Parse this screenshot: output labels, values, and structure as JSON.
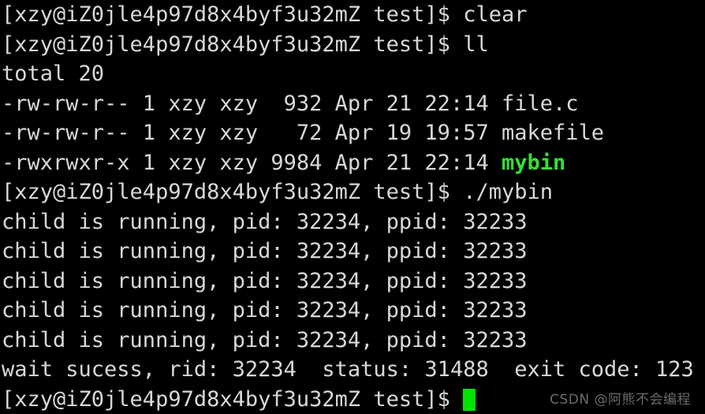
{
  "terminal": {
    "background_color": "#000000",
    "foreground_color": "#d8d8d8",
    "executable_color": "#35e035",
    "cursor_color": "#00e500",
    "prompt": "[xzy@iZ0jle4p97d8x4byf3u32mZ test]$ ",
    "lines": [
      {
        "id": "line-1",
        "type": "prompt-command",
        "prompt": "[xzy@iZ0jle4p97d8x4byf3u32mZ test]$ ",
        "command": "clear"
      },
      {
        "id": "line-2",
        "type": "prompt-command",
        "prompt": "[xzy@iZ0jle4p97d8x4byf3u32mZ test]$ ",
        "command": "ll"
      },
      {
        "id": "line-3",
        "type": "output",
        "text": "total 20"
      },
      {
        "id": "line-4",
        "type": "file-entry",
        "text": "-rw-rw-r-- 1 xzy xzy  932 Apr 21 22:14 ",
        "name": "file.c",
        "executable": false
      },
      {
        "id": "line-5",
        "type": "file-entry",
        "text": "-rw-rw-r-- 1 xzy xzy   72 Apr 19 19:57 ",
        "name": "makefile",
        "executable": false
      },
      {
        "id": "line-6",
        "type": "file-entry",
        "text": "-rwxrwxr-x 1 xzy xzy 9984 Apr 21 22:14 ",
        "name": "mybin",
        "executable": true
      },
      {
        "id": "line-7",
        "type": "prompt-command",
        "prompt": "[xzy@iZ0jle4p97d8x4byf3u32mZ test]$ ",
        "command": "./mybin"
      },
      {
        "id": "line-8",
        "type": "output",
        "text": "child is running, pid: 32234, ppid: 32233"
      },
      {
        "id": "line-9",
        "type": "output",
        "text": "child is running, pid: 32234, ppid: 32233"
      },
      {
        "id": "line-10",
        "type": "output",
        "text": "child is running, pid: 32234, ppid: 32233"
      },
      {
        "id": "line-11",
        "type": "output",
        "text": "child is running, pid: 32234, ppid: 32233"
      },
      {
        "id": "line-12",
        "type": "output",
        "text": "child is running, pid: 32234, ppid: 32233"
      },
      {
        "id": "line-13",
        "type": "output",
        "text": "wait sucess, rid: 32234  status: 31488  exit code: 123"
      },
      {
        "id": "line-14",
        "type": "prompt-cursor",
        "prompt": "[xzy@iZ0jle4p97d8x4byf3u32mZ test]$ ",
        "command": ""
      }
    ]
  },
  "files": [
    {
      "permissions": "-rw-rw-r--",
      "links": "1",
      "owner": "xzy",
      "group": "xzy",
      "size": "932",
      "month": "Apr",
      "day": "21",
      "time": "22:14",
      "name": "file.c"
    },
    {
      "permissions": "-rw-rw-r--",
      "links": "1",
      "owner": "xzy",
      "group": "xzy",
      "size": "72",
      "month": "Apr",
      "day": "19",
      "time": "19:57",
      "name": "makefile"
    },
    {
      "permissions": "-rwxrwxr-x",
      "links": "1",
      "owner": "xzy",
      "group": "xzy",
      "size": "9984",
      "month": "Apr",
      "day": "21",
      "time": "22:14",
      "name": "mybin"
    }
  ],
  "process_info": {
    "child_pid": "32234",
    "child_ppid": "32233",
    "wait_rid": "32234",
    "status": "31488",
    "exit_code": "123"
  },
  "watermark": {
    "text": "CSDN @阿熊不会编程"
  }
}
